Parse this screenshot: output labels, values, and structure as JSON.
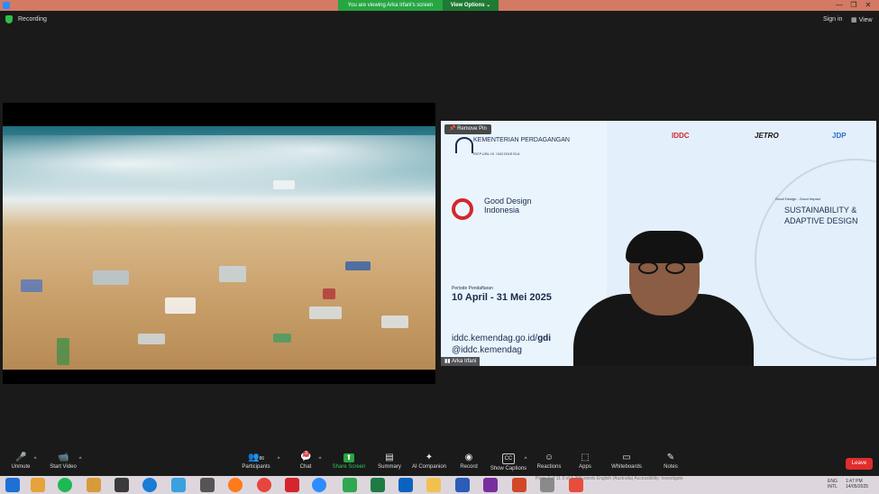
{
  "titlebar": {
    "share_banner": "You are viewing Arka Irfani's screen",
    "view_options": "View Options",
    "controls": [
      "—",
      "❐",
      "✕"
    ]
  },
  "top": {
    "recording": "Recording",
    "sign_in": "Sign in",
    "view": "View"
  },
  "right_video": {
    "remove_pin": "Remove Pin",
    "kementerian": "KEMENTERIAN PERDAGANGAN",
    "republik": "REPUBLIK INDONESIA",
    "gdi_title": "Good Design Indonesia",
    "periode_label": "Periode Pendaftaran",
    "periode_date": "10 April - 31 Mei 2025",
    "website_prefix": "iddc.kemendag.go.id/",
    "website_suffix": "gdi",
    "instagram": "@iddc.kemendag",
    "sponsor_iddc": "IDDC",
    "sponsor_jetro": "JETRO",
    "sponsor_jdp": "JDP",
    "tagline": "Good Design - Good Impact",
    "theme": "SUSTAINABILITY & ADAPTIVE DESIGN",
    "name_tag": "Arka Irfani"
  },
  "toolbar": {
    "items": [
      {
        "label": "Unmute",
        "icon": "🎤"
      },
      {
        "label": "Start Video",
        "icon": "📹"
      },
      {
        "label": "Participants",
        "icon": "👥",
        "count": "86"
      },
      {
        "label": "Chat",
        "icon": "💬",
        "badge": "3"
      },
      {
        "label": "Share Screen",
        "icon": "⬆"
      },
      {
        "label": "Summary",
        "icon": "▤"
      },
      {
        "label": "AI Companion",
        "icon": "✦"
      },
      {
        "label": "Record",
        "icon": "◉"
      },
      {
        "label": "Show Captions",
        "icon": "CC"
      },
      {
        "label": "Reactions",
        "icon": "☺"
      },
      {
        "label": "Apps",
        "icon": "⬚"
      },
      {
        "label": "Whiteboards",
        "icon": "▭"
      },
      {
        "label": "Notes",
        "icon": "✎"
      }
    ],
    "leave": "Leave"
  },
  "taskbar": {
    "status_text": "Page 2 of 11    3 of 1,200 words    English (Australia)    Accessibility: Investigate",
    "lang": "ENG",
    "lang_sub": "INTL",
    "time": "1:47 PM",
    "date": "14/05/2025"
  },
  "colors": {
    "title_bar": "#d27a64",
    "banner_green": "#26a641",
    "leave_red": "#e02d2d",
    "gdi_red": "#d4262c",
    "navy": "#1b2b4b"
  }
}
